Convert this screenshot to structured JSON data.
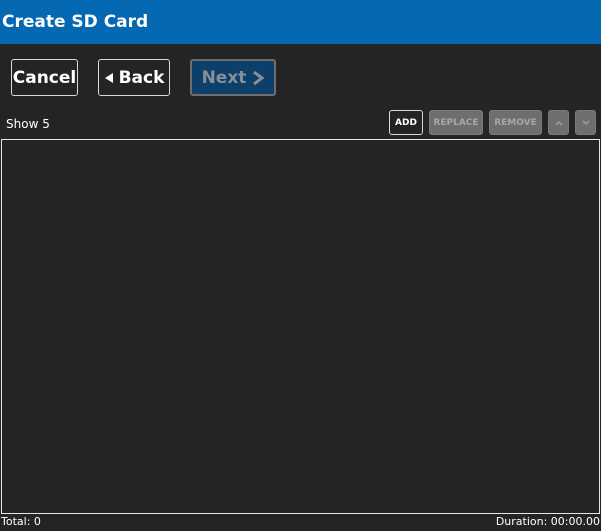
{
  "window": {
    "title": "Create SD Card"
  },
  "nav": {
    "cancel_label": "Cancel",
    "back_label": "Back",
    "next_label": "Next"
  },
  "list_header": {
    "show_label": "Show 5"
  },
  "toolbar": {
    "add_label": "ADD",
    "replace_label": "REPLACE",
    "remove_label": "REMOVE",
    "move_up_icon": "caret-up-icon",
    "move_down_icon": "caret-down-icon"
  },
  "list": {
    "items": []
  },
  "footer": {
    "total_label": "Total:",
    "total_value": "0",
    "duration_label": "Duration:",
    "duration_value": "00:00.00"
  },
  "colors": {
    "titlebar": "#0568b3",
    "background": "#242424",
    "next_button": "#0c3f6a",
    "disabled_button": "#6e6e6e"
  }
}
